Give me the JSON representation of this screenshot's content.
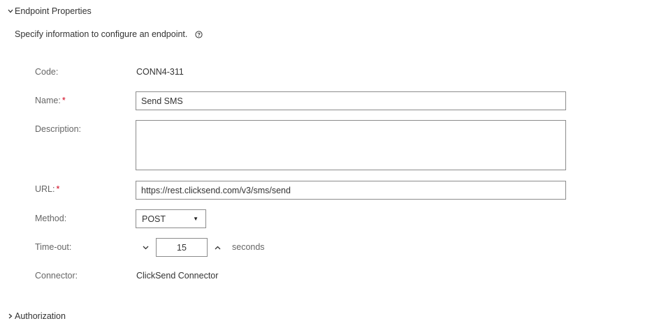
{
  "sections": {
    "endpoint_properties": {
      "title": "Endpoint Properties",
      "expanded": true
    },
    "authorization": {
      "title": "Authorization",
      "expanded": false
    }
  },
  "intro": {
    "text": "Specify information to configure an endpoint."
  },
  "form": {
    "code": {
      "label": "Code:",
      "value": "CONN4-311"
    },
    "name": {
      "label": "Name:",
      "required_mark": "*",
      "value": "Send SMS"
    },
    "description": {
      "label": "Description:",
      "value": ""
    },
    "url": {
      "label": "URL:",
      "required_mark": "*",
      "value": "https://rest.clicksend.com/v3/sms/send"
    },
    "method": {
      "label": "Method:",
      "selected": "POST"
    },
    "timeout": {
      "label": "Time-out:",
      "value": "15",
      "unit": "seconds"
    },
    "connector": {
      "label": "Connector:",
      "value": "ClickSend Connector"
    }
  },
  "colors": {
    "required": "#d0021b",
    "label": "#666666",
    "text": "#333333",
    "border": "#8c8c8c"
  },
  "icons": {
    "expand_chevron": "chevron-down-icon",
    "collapse_chevron": "chevron-right-icon",
    "help": "help-icon",
    "select_caret": "caret-down-icon",
    "decrement": "chevron-down-icon",
    "increment": "chevron-up-icon"
  }
}
